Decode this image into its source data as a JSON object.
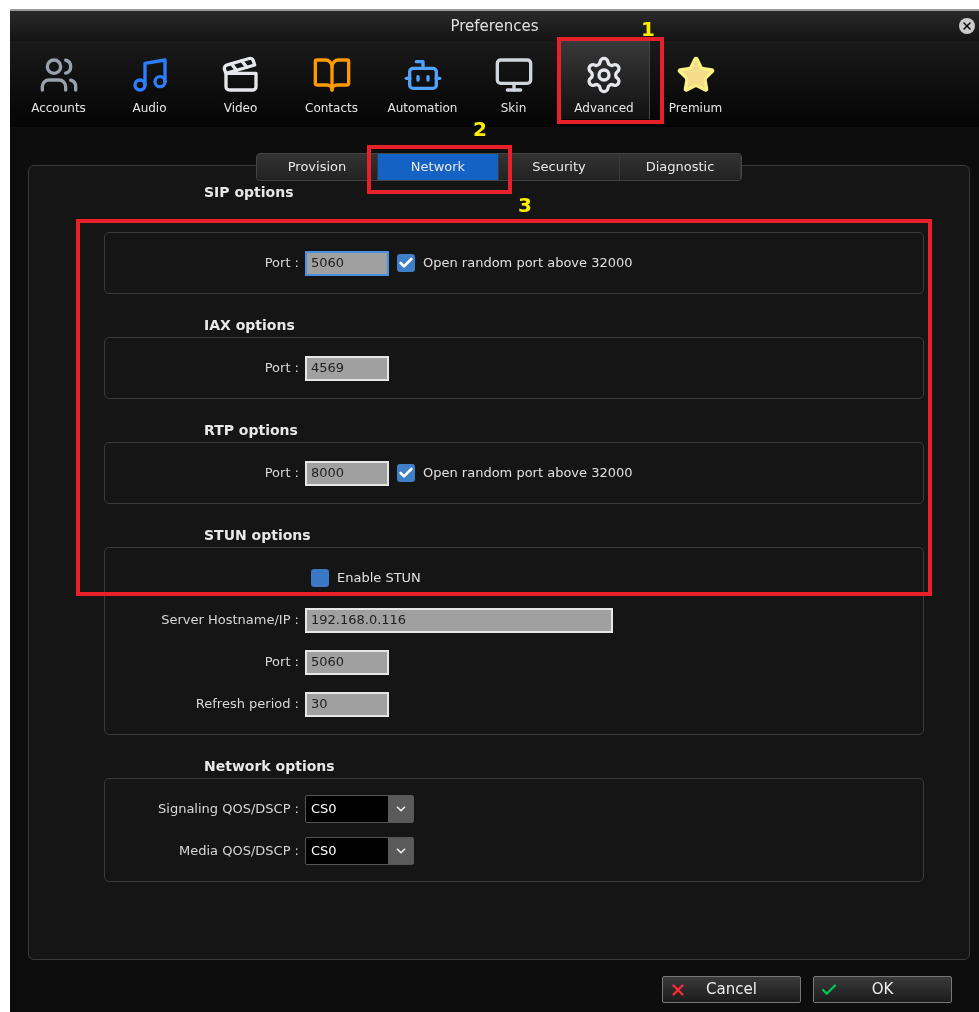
{
  "window": {
    "title": "Preferences"
  },
  "toolbar": [
    {
      "label": "Accounts",
      "selected": false
    },
    {
      "label": "Audio",
      "selected": false
    },
    {
      "label": "Video",
      "selected": false
    },
    {
      "label": "Contacts",
      "selected": false
    },
    {
      "label": "Automation",
      "selected": false
    },
    {
      "label": "Skin",
      "selected": false
    },
    {
      "label": "Advanced",
      "selected": true
    },
    {
      "label": "Premium",
      "selected": false
    }
  ],
  "tabs": [
    {
      "label": "Provision",
      "selected": false
    },
    {
      "label": "Network",
      "selected": true
    },
    {
      "label": "Security",
      "selected": false
    },
    {
      "label": "Diagnostic",
      "selected": false
    }
  ],
  "sections": [
    {
      "title": "SIP options",
      "rows": [
        {
          "kind": "field",
          "label": "Port :",
          "value": "5060",
          "focused": true,
          "checkbox": {
            "label": "Open random port above 32000",
            "checked": true
          }
        }
      ]
    },
    {
      "title": "IAX options",
      "rows": [
        {
          "kind": "field",
          "label": "Port :",
          "value": "4569",
          "focused": false
        }
      ]
    },
    {
      "title": "RTP options",
      "rows": [
        {
          "kind": "field",
          "label": "Port :",
          "value": "8000",
          "focused": false,
          "checkbox": {
            "label": "Open random port above 32000",
            "checked": true
          }
        }
      ]
    },
    {
      "title": "STUN options",
      "rows": [
        {
          "kind": "checkbox",
          "label": "Enable STUN",
          "checked": false
        },
        {
          "kind": "wide_field",
          "label": "Server Hostname/IP :",
          "value": "192.168.0.116",
          "focused": false
        },
        {
          "kind": "field",
          "label": "Port :",
          "value": "5060",
          "focused": false
        },
        {
          "kind": "field",
          "label": "Refresh period :",
          "value": "30",
          "focused": false
        }
      ]
    },
    {
      "title": "Network options",
      "rows": [
        {
          "kind": "select",
          "label": "Signaling QOS/DSCP :",
          "value": "CS0"
        },
        {
          "kind": "select",
          "label": "Media QOS/DSCP :",
          "value": "CS0"
        }
      ]
    }
  ],
  "buttons": [
    {
      "label": "Cancel",
      "kind": "cancel"
    },
    {
      "label": "OK",
      "kind": "ok"
    }
  ],
  "annotations": [
    {
      "label": "1"
    },
    {
      "label": "2"
    },
    {
      "label": "3"
    }
  ]
}
